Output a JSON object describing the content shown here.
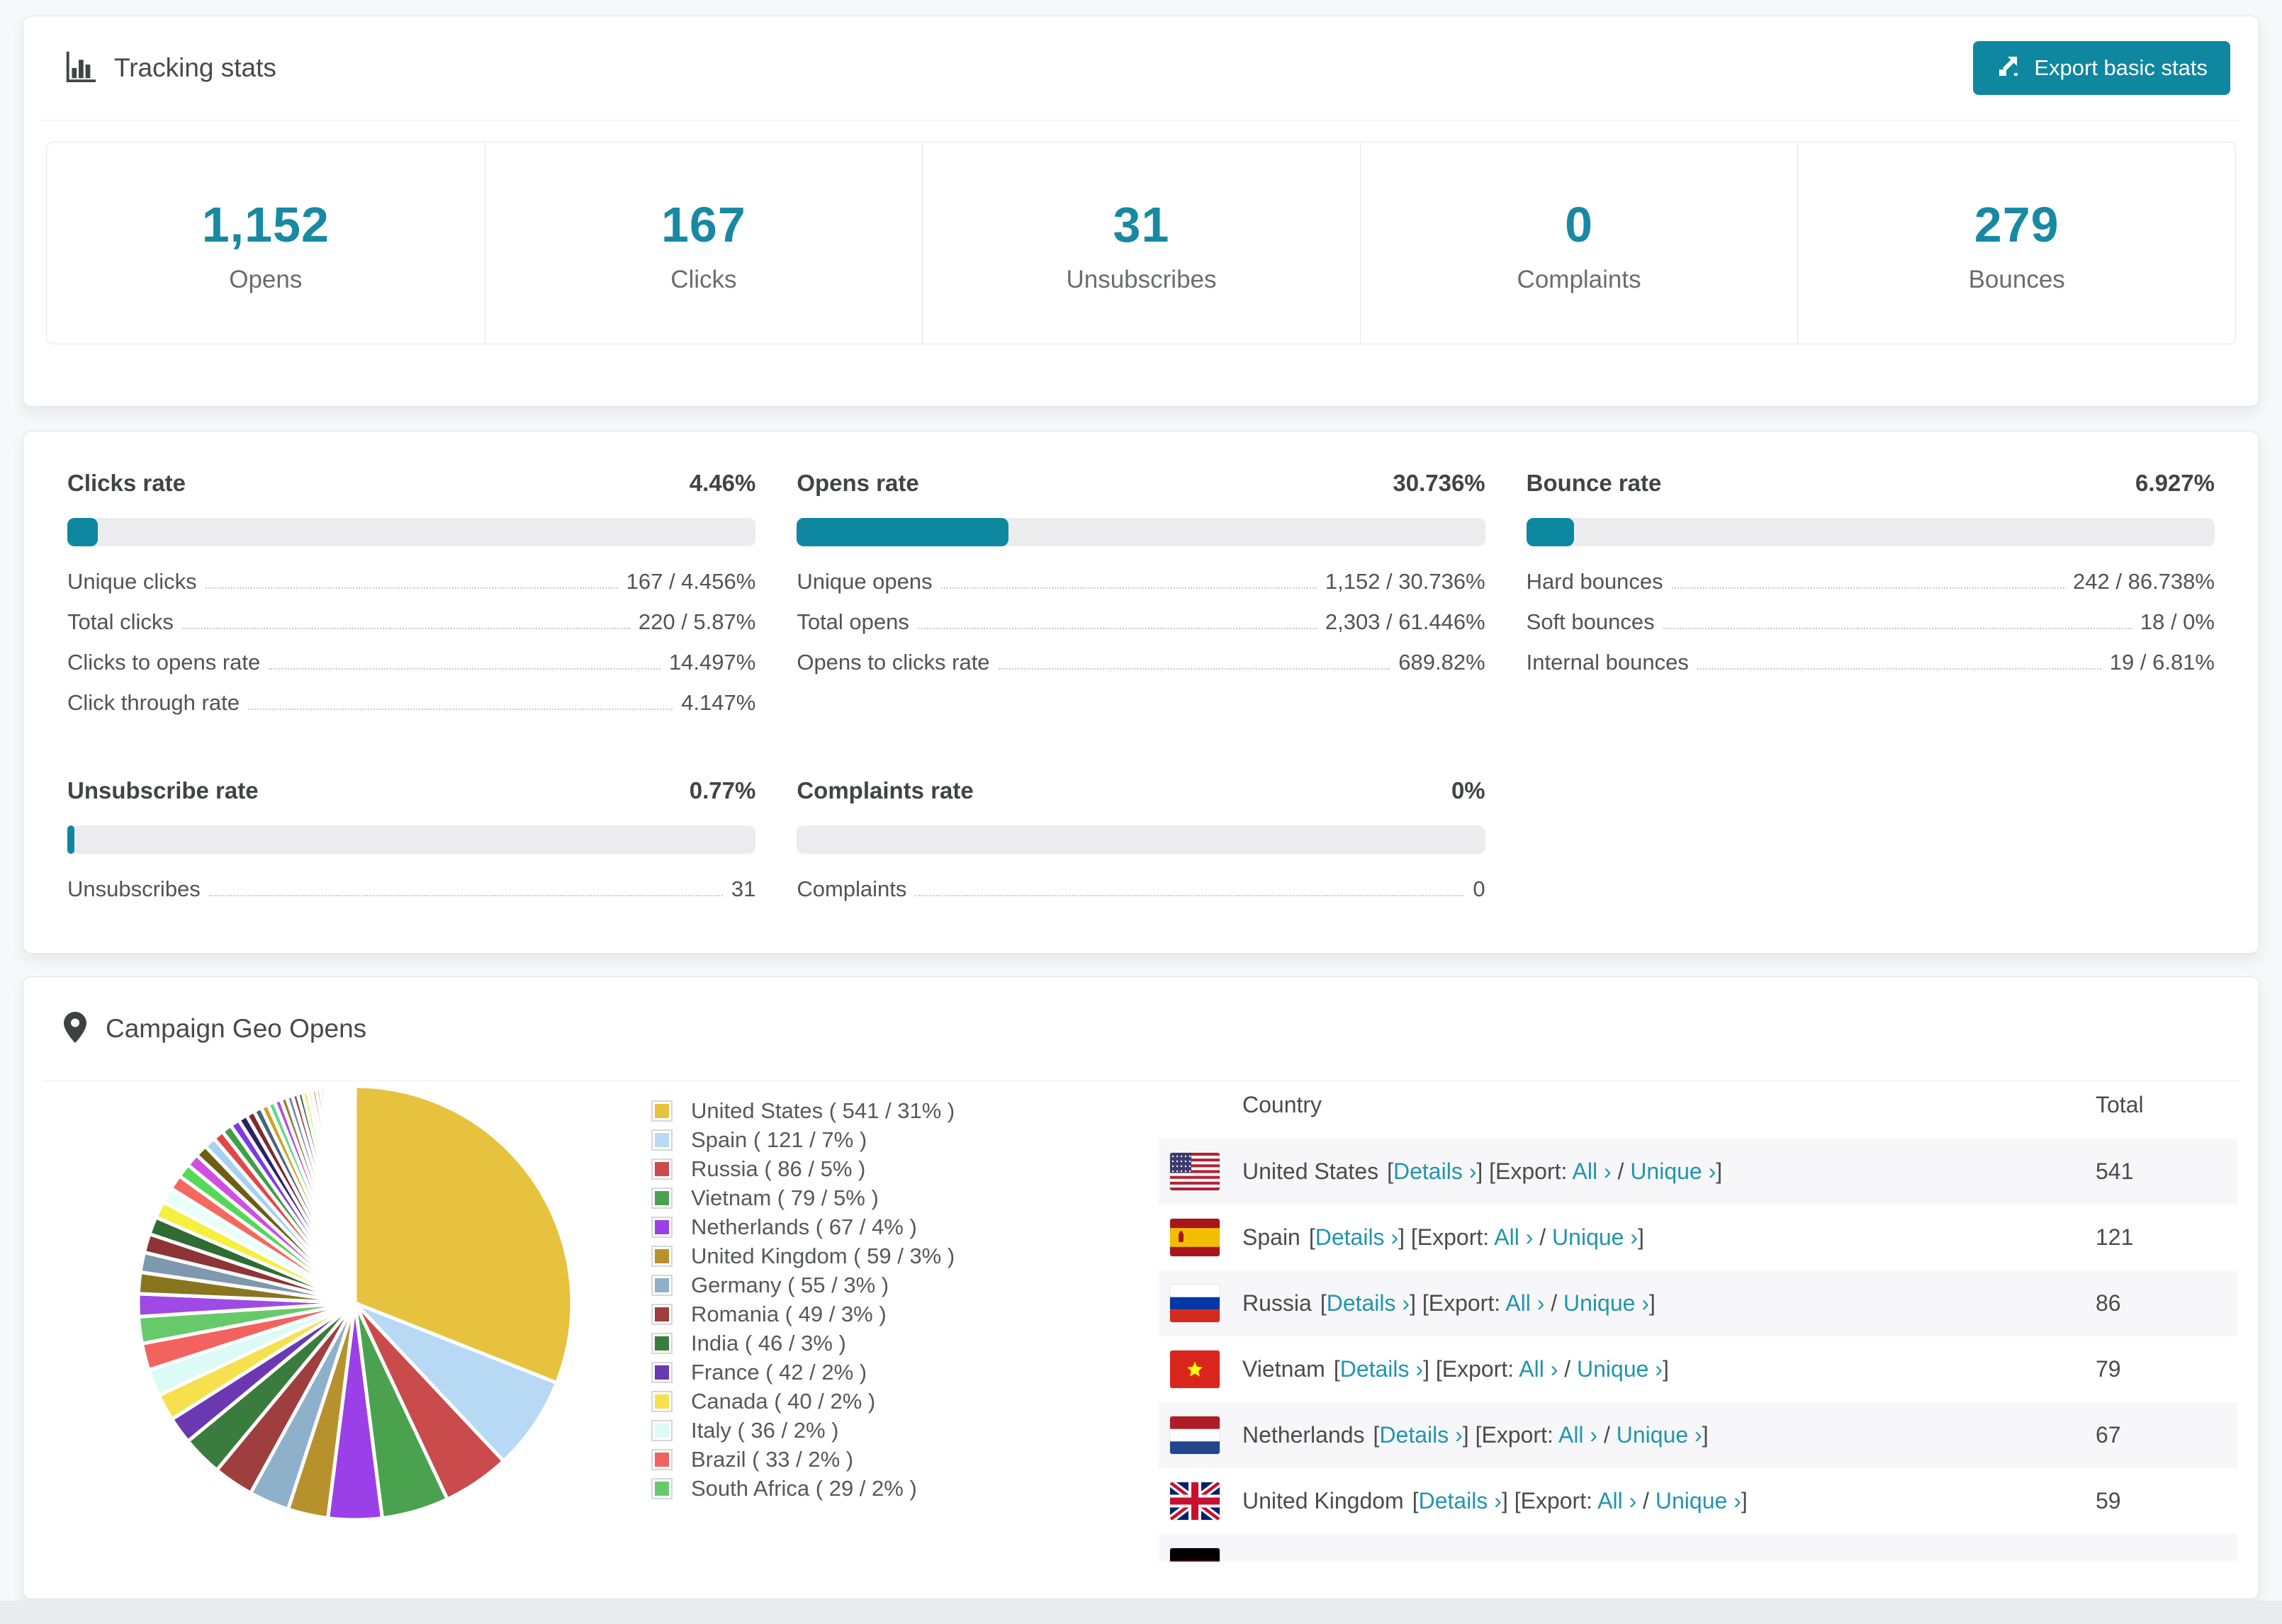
{
  "colors": {
    "accent": "#0e87a1",
    "link": "#2095af",
    "big_number": "#1789a3"
  },
  "tracking": {
    "title": "Tracking stats",
    "export_button": "Export basic stats",
    "stats": [
      {
        "value": "1,152",
        "label": "Opens"
      },
      {
        "value": "167",
        "label": "Clicks"
      },
      {
        "value": "31",
        "label": "Unsubscribes"
      },
      {
        "value": "0",
        "label": "Complaints"
      },
      {
        "value": "279",
        "label": "Bounces"
      }
    ]
  },
  "rates": [
    {
      "title": "Clicks rate",
      "percent_label": "4.46%",
      "bar_percent": 4.46,
      "rows": [
        {
          "label": "Unique clicks",
          "value": "167 / 4.456%"
        },
        {
          "label": "Total clicks",
          "value": "220 / 5.87%"
        },
        {
          "label": "Clicks to opens rate",
          "value": "14.497%"
        },
        {
          "label": "Click through rate",
          "value": "4.147%"
        }
      ]
    },
    {
      "title": "Opens rate",
      "percent_label": "30.736%",
      "bar_percent": 30.736,
      "rows": [
        {
          "label": "Unique opens",
          "value": "1,152 / 30.736%"
        },
        {
          "label": "Total opens",
          "value": "2,303 / 61.446%"
        },
        {
          "label": "Opens to clicks rate",
          "value": "689.82%"
        }
      ]
    },
    {
      "title": "Bounce rate",
      "percent_label": "6.927%",
      "bar_percent": 6.927,
      "rows": [
        {
          "label": "Hard bounces",
          "value": "242 / 86.738%"
        },
        {
          "label": "Soft bounces",
          "value": "18 / 0%"
        },
        {
          "label": "Internal bounces",
          "value": "19 / 6.81%"
        }
      ]
    },
    {
      "title": "Unsubscribe rate",
      "percent_label": "0.77%",
      "bar_percent": 0.77,
      "rows": [
        {
          "label": "Unsubscribes",
          "value": "31"
        }
      ]
    },
    {
      "title": "Complaints rate",
      "percent_label": "0%",
      "bar_percent": 0,
      "rows": [
        {
          "label": "Complaints",
          "value": "0"
        }
      ]
    }
  ],
  "geo": {
    "title": "Campaign Geo Opens",
    "chart_data": {
      "type": "pie",
      "title": "Campaign Geo Opens",
      "legend_position": "right",
      "start_angle_deg": 0,
      "clockwise": true,
      "slices": [
        {
          "label": "United States",
          "value": 541,
          "percent": 31,
          "color": "#e6c23e"
        },
        {
          "label": "Spain",
          "value": 121,
          "percent": 7,
          "color": "#b7d9f3"
        },
        {
          "label": "Russia",
          "value": 86,
          "percent": 5,
          "color": "#c94b4c"
        },
        {
          "label": "Vietnam",
          "value": 79,
          "percent": 5,
          "color": "#4ba24e"
        },
        {
          "label": "Netherlands",
          "value": 67,
          "percent": 4,
          "color": "#9b3fe8"
        },
        {
          "label": "United Kingdom",
          "value": 59,
          "percent": 3,
          "color": "#b7922c"
        },
        {
          "label": "Germany",
          "value": 55,
          "percent": 3,
          "color": "#8fb0ca"
        },
        {
          "label": "Romania",
          "value": 49,
          "percent": 3,
          "color": "#9e3e3e"
        },
        {
          "label": "India",
          "value": 46,
          "percent": 3,
          "color": "#3a7c3e"
        },
        {
          "label": "France",
          "value": 42,
          "percent": 2,
          "color": "#6a38b0"
        },
        {
          "label": "Canada",
          "value": 40,
          "percent": 2,
          "color": "#f6e04e"
        },
        {
          "label": "Italy",
          "value": 36,
          "percent": 2,
          "color": "#dcfbf6"
        },
        {
          "label": "Brazil",
          "value": 33,
          "percent": 2,
          "color": "#f2635f"
        },
        {
          "label": "South Africa",
          "value": 29,
          "percent": 2,
          "color": "#67ca6a"
        }
      ],
      "other_unlabeled_slices_percent": 26
    },
    "legend_format": "{label} ( {value} / {percent}% )",
    "table": {
      "headers": {
        "country": "Country",
        "total": "Total"
      },
      "link_text": {
        "open": "[",
        "details": "Details ›",
        "export_open": "] [Export: ",
        "all": "All ›",
        "separator": " / ",
        "unique": "Unique ›",
        "close": "]"
      },
      "rows": [
        {
          "flag": "us",
          "country": "United States",
          "total": "541"
        },
        {
          "flag": "es",
          "country": "Spain",
          "total": "121"
        },
        {
          "flag": "ru",
          "country": "Russia",
          "total": "86"
        },
        {
          "flag": "vn",
          "country": "Vietnam",
          "total": "79"
        },
        {
          "flag": "nl",
          "country": "Netherlands",
          "total": "67"
        },
        {
          "flag": "gb",
          "country": "United Kingdom",
          "total": "59"
        }
      ],
      "partial_row": {
        "flag": "de"
      }
    }
  }
}
